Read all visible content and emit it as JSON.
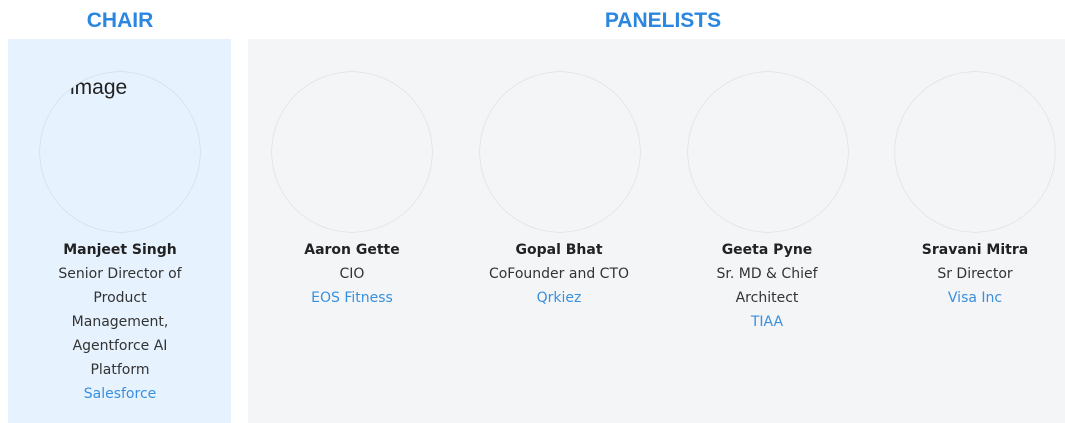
{
  "headings": {
    "chair": "CHAIR",
    "panelists": "PANELISTS"
  },
  "chair": {
    "photo_alt": "Chair image",
    "name": "Manjeet Singh",
    "title_lines": [
      "Senior Director of",
      "Product",
      "Management,",
      "Agentforce AI",
      "Platform"
    ],
    "company": "Salesforce"
  },
  "panelists": [
    {
      "name": "Aaron Gette",
      "title_lines": [
        "CIO"
      ],
      "company": "EOS Fitness"
    },
    {
      "name": "Gopal Bhat",
      "title_lines": [
        "CoFounder and CTO"
      ],
      "company": "Qrkiez"
    },
    {
      "name": "Geeta Pyne",
      "title_lines": [
        "Sr. MD & Chief",
        "Architect"
      ],
      "company": "TIAA"
    },
    {
      "name": "Sravani Mitra",
      "title_lines": [
        "Sr Director"
      ],
      "company": "Visa Inc"
    }
  ],
  "colors": {
    "accent": "#2b86e0",
    "link": "#3a8fdd",
    "chair_bg": "#e6f2fe",
    "panel_bg": "#f3f5f7"
  }
}
